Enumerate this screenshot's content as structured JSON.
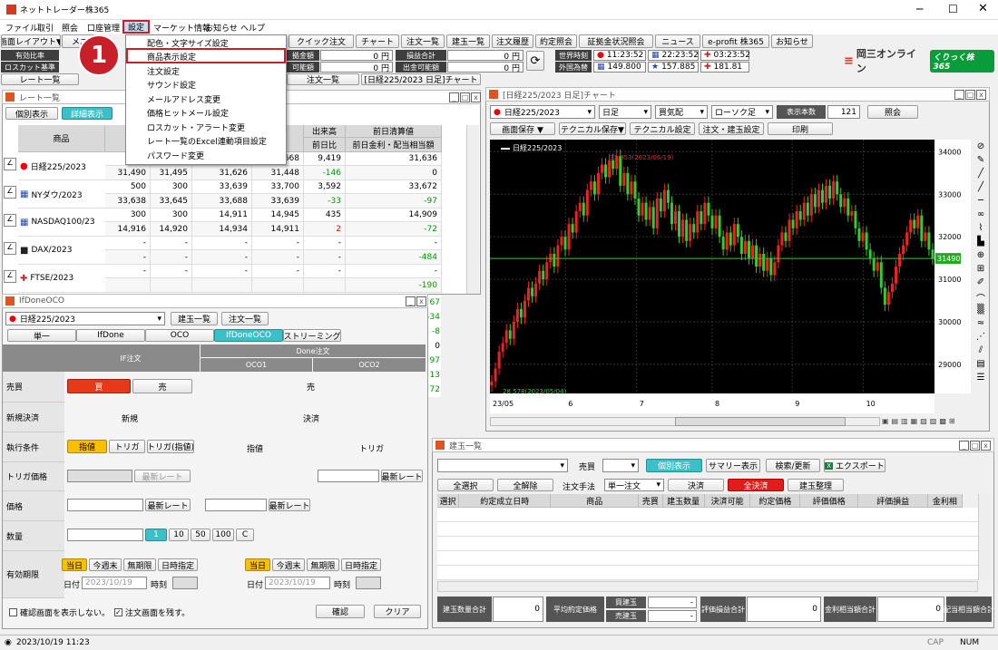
{
  "app": {
    "title": "ネットトレーダー株365"
  },
  "menubar": [
    "ファイル",
    "取引",
    "照会",
    "口座管理",
    "設定",
    "マーケット情報",
    "お知らせ",
    "ヘルプ"
  ],
  "settings_menu": [
    "配色・文字サイズ設定",
    "商品表示設定",
    "注文設定",
    "サウンド設定",
    "メールアドレス変更",
    "価格ヒットメール設定",
    "ロスカット・アラート変更",
    "レート一覧のExcel連動項目設定",
    "パスワード変更"
  ],
  "callout": "1",
  "toolbar1": {
    "layout": "画面レイアウト▼",
    "me": "メニ",
    "quick_order": "クイック注文",
    "chart": "チャート",
    "orders": "注文一覧",
    "positions": "建玉一覧",
    "history": "注文履歴",
    "contract": "約定照会",
    "margin": "証拠金状況照会",
    "news": "ニュース",
    "eprofit": "e-profit 株365",
    "notice": "お知らせ"
  },
  "toolbar2": {
    "valid_rate": "有効比率",
    "loss_cut": "ロスカット基準",
    "rate_list": "レート一覧",
    "kin": "拠金額",
    "kanou": "可能額",
    "v1": "0 円",
    "v2": "0 円",
    "pl_total": "損益合計",
    "withdraw": "出金可能額",
    "v3": "0 円",
    "v4": "0 円",
    "world_time": "世界時刻",
    "fx": "外国為替",
    "t_jp": "11:23:52",
    "t_us": "22:23:52",
    "t_uk": "03:23:52",
    "fx_jpy": "149.800",
    "fx_eur": "157.885",
    "fx_gbp": "181.81"
  },
  "tabs": {
    "order_list": "注文一覧",
    "chart_tab": "[日経225/2023 日足]チャート"
  },
  "logo": {
    "name": "岡三オンライン",
    "brand": "くりっく株365"
  },
  "rate_window": {
    "title": "レート一覧",
    "individual": "個別表示",
    "detail": "詳細表示",
    "product": "商品",
    "vol": "出来高",
    "prev_day_ratio": "前日比",
    "prev_settle": "前日清算値",
    "dividend": "前日金利・配当相当額",
    "rows": [
      {
        "name": "日経225/2023",
        "bid": "",
        "ask": "",
        "h1": "",
        "h2": "33,668",
        "vol": "9,419",
        "prev": "31,636",
        "b2": "31,490",
        "a2": "31,495",
        "l1": "31,626",
        "l2": "31,448",
        "chg": "-146",
        "div": "0"
      },
      {
        "name": "NYダウ/2023",
        "bid": "500",
        "ask": "300",
        "h1": "33,639",
        "h2": "33,700",
        "vol": "3,592",
        "prev": "33,672",
        "b2": "33,638",
        "a2": "33,645",
        "l1": "33,688",
        "l2": "33,639",
        "chg": "-33",
        "div": "-97"
      },
      {
        "name": "NASDAQ100/23",
        "bid": "300",
        "ask": "300",
        "h1": "14,911",
        "h2": "14,945",
        "vol": "435",
        "prev": "14,909",
        "b2": "14,916",
        "a2": "14,920",
        "l1": "14,934",
        "l2": "14,911",
        "chg": "2",
        "div": "-72"
      },
      {
        "name": "DAX/2023",
        "bid": "-",
        "ask": "-",
        "h1": "-",
        "h2": "-",
        "vol": "-",
        "prev": "-",
        "b2": "-",
        "a2": "-",
        "l1": "-",
        "l2": "-",
        "chg": "-",
        "div": "-484"
      },
      {
        "name": "FTSE/2023",
        "bid": "-",
        "ask": "-",
        "h1": "-",
        "h2": "-",
        "vol": "-",
        "prev": "-",
        "b2": "",
        "a2": "",
        "l1": "",
        "l2": "",
        "chg": "",
        "div": "-190"
      }
    ]
  },
  "side_vals": [
    "67",
    "-34",
    "-8",
    "0",
    "97",
    "13",
    "72"
  ],
  "ifdone": {
    "title": "IfDoneOCO",
    "product": "日経225/2023",
    "pos_list": "建玉一覧",
    "ord_list": "注文一覧",
    "tabs": [
      "単一",
      "IfDone",
      "OCO",
      "IfDoneOCO",
      "ストリーミング"
    ],
    "if_order": "IF注文",
    "done_order": "Done注文",
    "oco1": "OCO1",
    "oco2": "OCO2",
    "side": "売買",
    "buy": "買",
    "sell": "売",
    "sell2": "売",
    "newclose": "新規決済",
    "new": "新規",
    "close": "決済",
    "cond": "執行条件",
    "limit": "指値",
    "trigger": "トリガ",
    "trigger_limit": "トリガ(指値)",
    "limit2": "指値",
    "trigger2": "トリガ",
    "trig_price": "トリガ価格",
    "latest": "最新レート",
    "price": "価格",
    "qty": "数量",
    "q1": "1",
    "q10": "10",
    "q50": "50",
    "q100": "100",
    "qc": "C",
    "valid": "有効期限",
    "today": "当日",
    "week": "今週末",
    "indef": "無期限",
    "datetime": "日時指定",
    "date": "日付",
    "date_val": "2023/10/19",
    "time": "時刻",
    "no_confirm": "確認画面を表示しない。",
    "keep_screen": "注文画面を残す。",
    "confirm": "確認",
    "clear": "クリア"
  },
  "chart_window": {
    "title": "[日経225/2023 日足]チャート",
    "product": "日経225/2023",
    "period": "日足",
    "side": "買気配",
    "type": "ローソク足",
    "count_label": "表示本数",
    "count": "121",
    "inquiry": "照会",
    "save": "画面保存 ▼",
    "tech_save": "テクニカル保存▼",
    "tech_set": "テクニカル設定",
    "order_pos": "注文・建玉設定",
    "print": "印刷",
    "legend": "日経225/2023",
    "hi_label": "33,953(2023/06/19)",
    "lo_label": "28,578(2023/05/04)",
    "cur": "31490"
  },
  "chart_data": {
    "type": "candlestick",
    "title": "日経225/2023",
    "ylim": [
      28400,
      34200
    ],
    "yticks": [
      "34000",
      "33000",
      "32000",
      "31000",
      "30000",
      "29000"
    ],
    "xticks": [
      "23/05",
      "6",
      "7",
      "8",
      "9",
      "10"
    ],
    "close": [
      28600,
      28900,
      29300,
      29500,
      29800,
      29600,
      30000,
      30300,
      30100,
      30500,
      30800,
      30600,
      30900,
      31200,
      31000,
      31400,
      31600,
      31300,
      31800,
      32000,
      31700,
      32300,
      32100,
      32600,
      32800,
      32500,
      33100,
      33300,
      33000,
      33500,
      33700,
      33400,
      33800,
      33600,
      33900,
      33200,
      33500,
      33000,
      33300,
      32900,
      32500,
      32800,
      32400,
      32700,
      32200,
      32900,
      32600,
      33100,
      32800,
      32300,
      32600,
      32000,
      32400,
      31900,
      32300,
      32100,
      32600,
      32300,
      32800,
      32500,
      32200,
      32500,
      32000,
      31700,
      32100,
      31800,
      32300,
      32000,
      31600,
      31900,
      31500,
      31800,
      31300,
      31600,
      31200,
      31500,
      31100,
      31400,
      31800,
      32100,
      31900,
      32400,
      32200,
      32600,
      32400,
      32800,
      32500,
      33000,
      32700,
      33100,
      32800,
      33200,
      32900,
      33300,
      33000,
      32700,
      32900,
      32500,
      32600,
      32200,
      31900,
      32100,
      31700,
      31500,
      31200,
      31400,
      30800,
      30400,
      30700,
      30900,
      31300,
      31600,
      31800,
      32100,
      32400,
      32200,
      32500,
      31900,
      32100,
      31700,
      31490
    ],
    "open": [
      28500,
      28600,
      28900,
      29300,
      29500,
      29800,
      29600,
      30000,
      30300,
      30100,
      30500,
      30800,
      30600,
      30900,
      31200,
      31000,
      31400,
      31600,
      31300,
      31800,
      32000,
      31700,
      32300,
      32100,
      32600,
      32800,
      32500,
      33100,
      33300,
      33000,
      33500,
      33700,
      33400,
      33800,
      33600,
      33900,
      33200,
      33500,
      33000,
      33300,
      32900,
      32500,
      32800,
      32400,
      32700,
      32200,
      32900,
      32600,
      33100,
      32800,
      32300,
      32600,
      32000,
      32400,
      31900,
      32300,
      32100,
      32600,
      32300,
      32800,
      32500,
      32200,
      32500,
      32000,
      31700,
      32100,
      31800,
      32300,
      32000,
      31600,
      31900,
      31500,
      31800,
      31300,
      31600,
      31200,
      31500,
      31100,
      31400,
      31800,
      32100,
      31900,
      32400,
      32200,
      32600,
      32400,
      32800,
      32500,
      33000,
      32700,
      33100,
      32800,
      33200,
      32900,
      33300,
      33000,
      32700,
      32900,
      32500,
      32600,
      32200,
      31900,
      32100,
      31700,
      31500,
      31200,
      31400,
      30800,
      30400,
      30700,
      30900,
      31300,
      31600,
      31800,
      32100,
      32400,
      32200,
      32500,
      31900,
      32100,
      31700
    ]
  },
  "positions_window": {
    "title": "建玉一覧",
    "side_label": "売買",
    "individual": "個別表示",
    "summary": "サマリー表示",
    "search": "検索/更新",
    "export": "エクスポート",
    "select_all": "全選択",
    "deselect_all": "全解除",
    "method": "注文手法",
    "method_val": "単一注文",
    "close": "決済",
    "close_all": "全決済",
    "arrange": "建玉整理",
    "cols": [
      "選択",
      "約定成立日時",
      "商品",
      "売買",
      "建玉数量",
      "決済可能",
      "約定価格",
      "評価価格",
      "評価損益",
      "金利相"
    ],
    "pos_total": "建玉数量合計",
    "pos_total_val": "0",
    "avg_price": "平均約定価格",
    "buy_pos": "買建玉",
    "sell_pos": "売建玉",
    "dash": "-",
    "dash2": "-",
    "eval_pl": "評価損益合計",
    "eval_val": "0",
    "interest": "金利相当額合計",
    "int_val": "0",
    "div_total": "配当相当額合計"
  },
  "status": {
    "time": "2023/10/19 11:23",
    "cap": "CAP",
    "num": "NUM"
  }
}
